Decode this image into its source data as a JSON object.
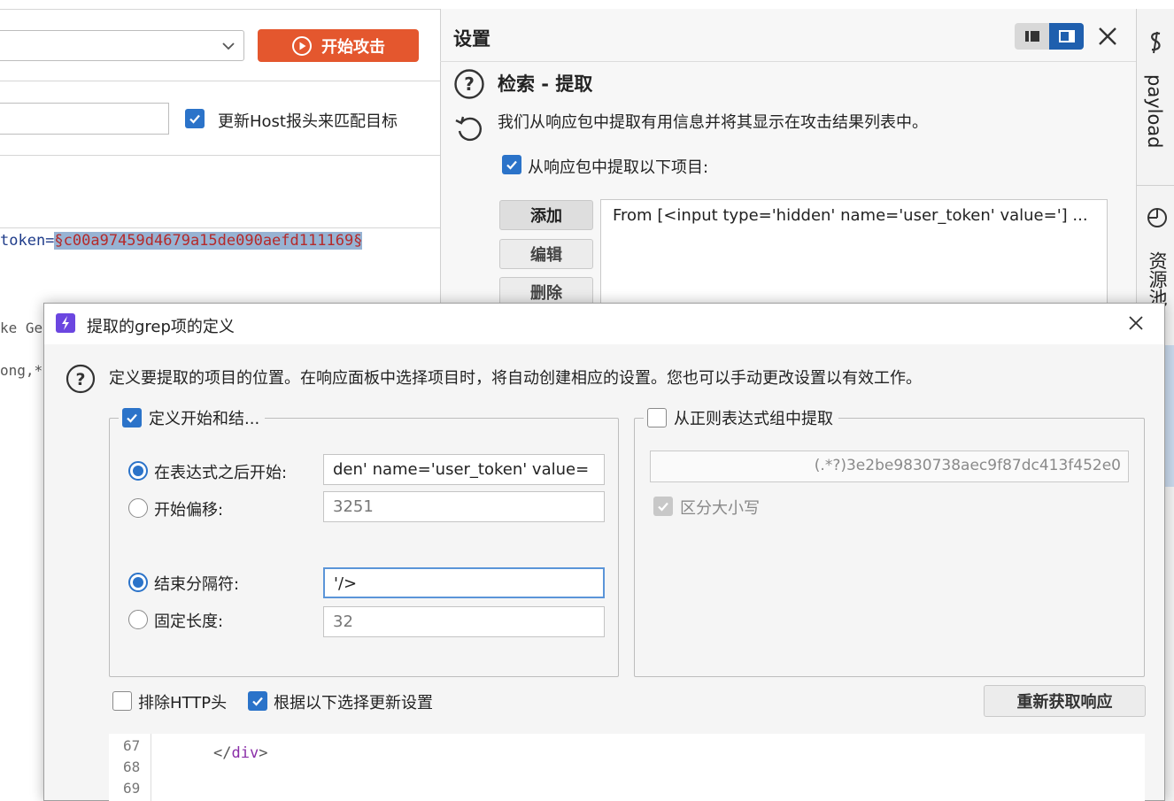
{
  "left": {
    "start_attack_label": "开始攻击",
    "host_update_label": "更新Host报头来匹配目标",
    "token_prefix": "token=",
    "token_value": "§c00a97459d4679a15de090aefd111169§",
    "code_fragment_1": "ke Ge",
    "code_fragment_2": "ong,*"
  },
  "settings": {
    "title": "设置",
    "section_title": "检索 - 提取",
    "section_desc": "我们从响应包中提取有用信息并将其显示在攻击结果列表中。",
    "extract_label": "从响应包中提取以下项目:",
    "add_label": "添加",
    "edit_label": "编辑",
    "delete_label": "删除",
    "items": [
      "From [<input type='hidden' name='user_token' value='] ..."
    ]
  },
  "right_strip": {
    "tab_payload": "payload",
    "tab_resource": "资源池"
  },
  "dialog": {
    "title": "提取的grep项的定义",
    "desc": "定义要提取的项目的位置。在响应面板中选择项目时，将自动创建相应的设置。您也可以手动更改设置以有效工作。",
    "group_left_label": "定义开始和结...",
    "start_after_label": "在表达式之后开始:",
    "start_after_value": "den' name='user_token' value=",
    "start_offset_label": "开始偏移:",
    "start_offset_value": "3251",
    "end_delim_label": "结束分隔符:",
    "end_delim_value": "'/>",
    "fixed_length_label": "固定长度:",
    "fixed_length_value": "32",
    "group_right_label": "从正则表达式组中提取",
    "regex_value": "(.*?)3e2be9830738aec9f87dc413f452e0",
    "case_sensitive_label": "区分大小写",
    "exclude_http_label": "排除HTTP头",
    "update_config_label": "根据以下选择更新设置",
    "refetch_label": "重新获取响应",
    "code_lines": [
      "67",
      "68",
      "69"
    ],
    "code_line_68_open": "</",
    "code_line_68_tag": "div",
    "code_line_68_close": ">"
  },
  "colors": {
    "accent": "#2b73c9",
    "attack_button": "#e4572e",
    "dialog_logo": "#6b46e0",
    "selection": "#97b3d3"
  }
}
